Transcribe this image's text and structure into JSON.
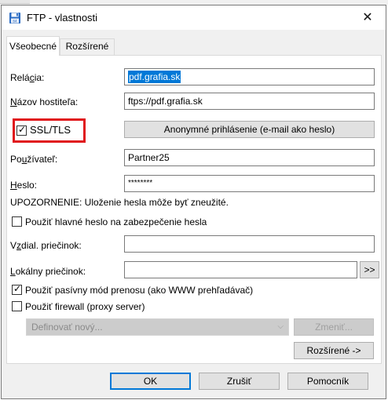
{
  "window": {
    "title": "FTP - vlastnosti",
    "close_glyph": "✕",
    "icon": "floppy-disk-icon"
  },
  "tabs": [
    {
      "label": "Všeobecné",
      "active": true
    },
    {
      "label": "Rozšírené",
      "active": false
    }
  ],
  "form": {
    "session_label_pre": "Relá",
    "session_label_u": "c",
    "session_label_post": "ia:",
    "session_value": "pdf.grafia.sk",
    "host_label_pre": "",
    "host_label_u": "N",
    "host_label_post": "ázov hostiteľa:",
    "host_value": "ftps://pdf.grafia.sk",
    "ssl_label": "SSL/TLS",
    "ssl_checked": true,
    "anon_button": "Anonymné prihlásenie (e-mail ako heslo)",
    "user_label_pre": "Po",
    "user_label_u": "u",
    "user_label_post": "žívateľ:",
    "user_value": "Partner25",
    "pass_label_pre": "",
    "pass_label_u": "H",
    "pass_label_post": "eslo:",
    "pass_value": "********",
    "warning": "UPOZORNENIE: Uloženie hesla môže byť zneužité.",
    "master_pw_label": "Použiť hlavné heslo na zabezpečenie hesla",
    "master_pw_checked": false,
    "remote_label_pre": "V",
    "remote_label_u": "z",
    "remote_label_post": "dial. priečinok:",
    "remote_value": "",
    "local_label_pre": "",
    "local_label_u": "L",
    "local_label_post": "okálny priečinok:",
    "local_value": "",
    "browse_button": ">>",
    "passive_label": "Použiť pasívny mód prenosu (ako WWW prehľadávač)",
    "passive_checked": true,
    "firewall_label": "Použiť firewall (proxy server)",
    "firewall_checked": false,
    "firewall_select": "Definovať nový...",
    "firewall_change_button": "Zmeniť...",
    "advanced_button": "Rozšírené ->"
  },
  "footer": {
    "ok": "OK",
    "cancel": "Zrušiť",
    "help": "Pomocník"
  },
  "colors": {
    "highlight": "#e0161b",
    "selection": "#0078d7",
    "default_button_border": "#0078d7"
  }
}
